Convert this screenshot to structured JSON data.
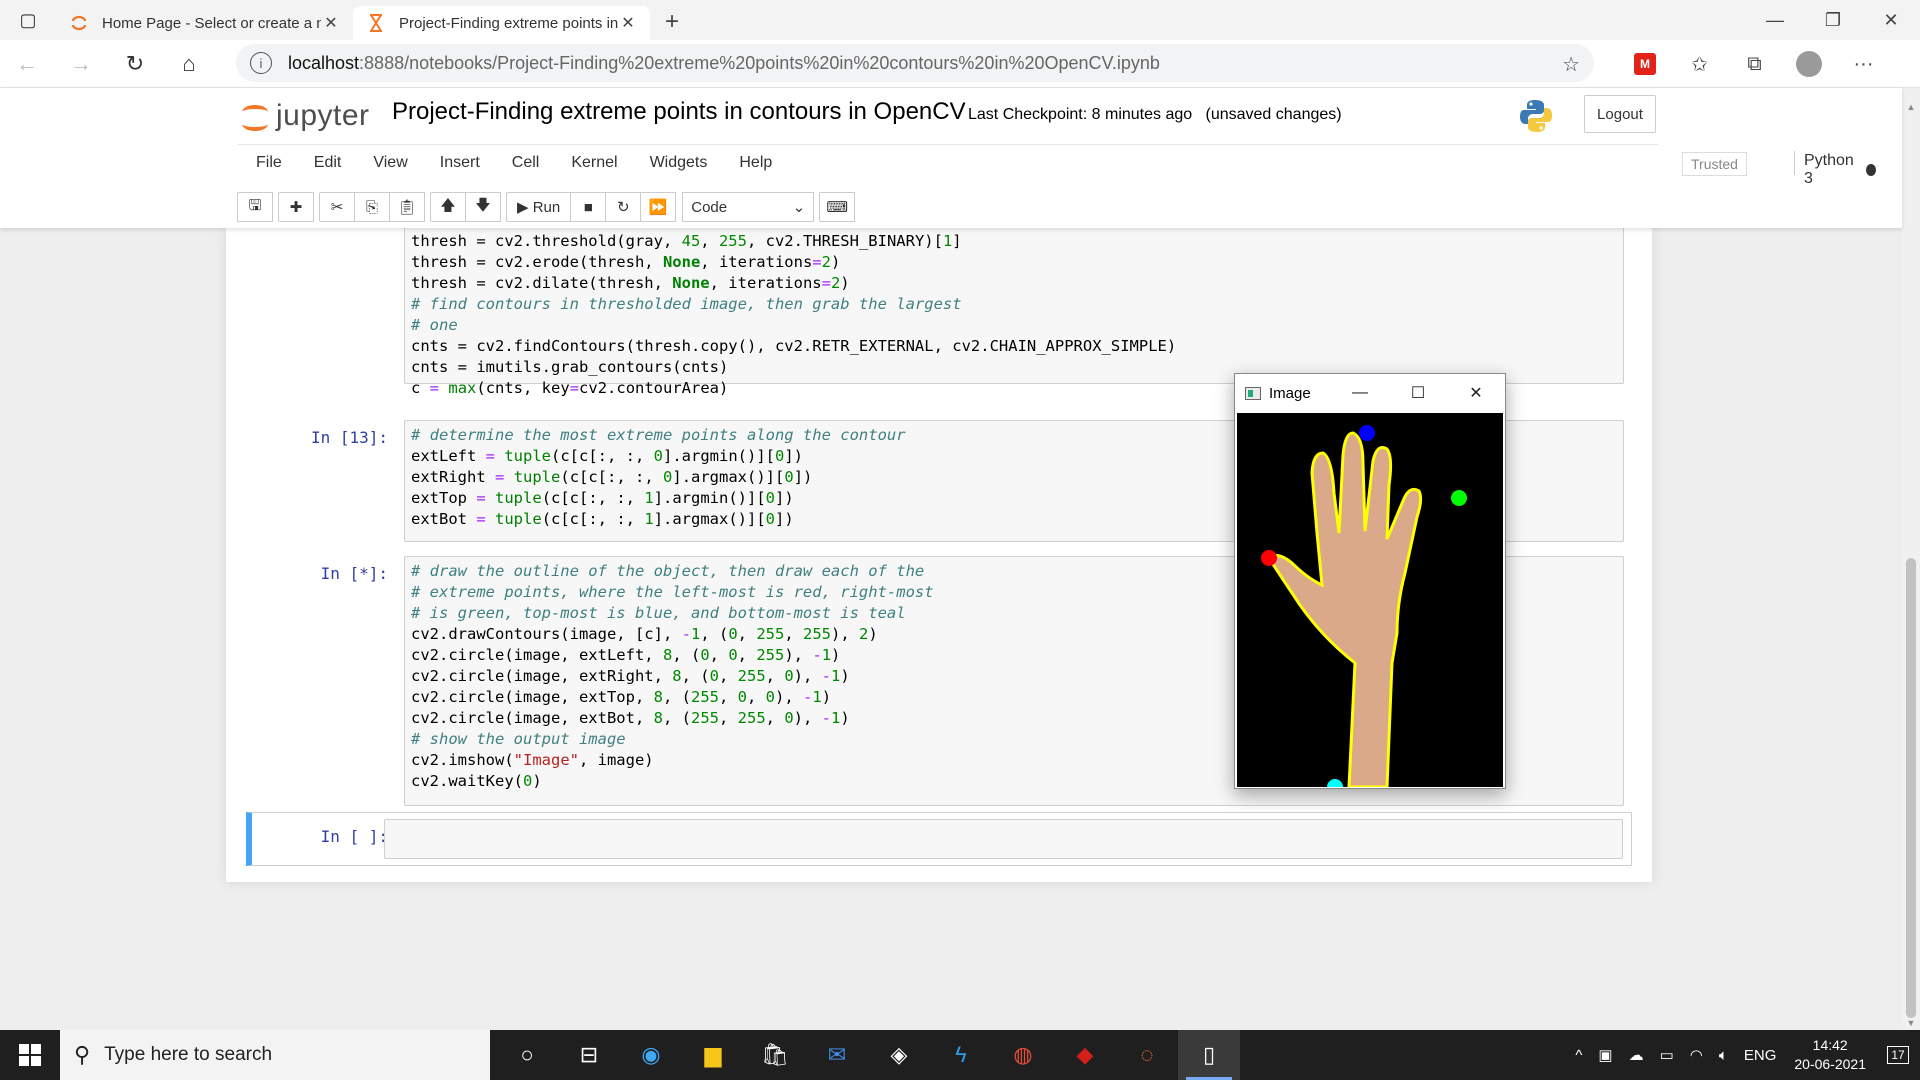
{
  "browser": {
    "tabs": [
      {
        "title": "Home Page - Select or create a n",
        "icon": "jupyter-spinner-icon",
        "active": false
      },
      {
        "title": "Project-Finding extreme points in",
        "icon": "hourglass-icon",
        "active": true
      }
    ],
    "url_host": "localhost",
    "url_path": ":8888/notebooks/Project-Finding%20extreme%20points%20in%20contours%20in%20OpenCV.ipynb"
  },
  "jupyter": {
    "logo_text": "jupyter",
    "notebook_title": "Project-Finding extreme points in contours in OpenCV",
    "checkpoint_label": "Last Checkpoint:",
    "checkpoint_time": "8 minutes ago",
    "unsaved": "(unsaved changes)",
    "logout_label": "Logout",
    "menu": [
      "File",
      "Edit",
      "View",
      "Insert",
      "Cell",
      "Kernel",
      "Widgets",
      "Help"
    ],
    "trusted_label": "Trusted",
    "kernel_name": "Python 3",
    "toolbar": {
      "run_label": "Run",
      "cell_type": "Code"
    }
  },
  "cells": [
    {
      "prompt": "",
      "lines": [
        "thresh = cv2.threshold(gray, 45, 255, cv2.THRESH_BINARY)[1]",
        "thresh = cv2.erode(thresh, None, iterations=2)",
        "thresh = cv2.dilate(thresh, None, iterations=2)",
        "# find contours in thresholded image, then grab the largest",
        "# one",
        "cnts = cv2.findContours(thresh.copy(), cv2.RETR_EXTERNAL, cv2.CHAIN_APPROX_SIMPLE)",
        "cnts = imutils.grab_contours(cnts)",
        "c = max(cnts, key=cv2.contourArea)"
      ]
    },
    {
      "prompt": "In [13]:",
      "lines": [
        "# determine the most extreme points along the contour",
        "extLeft = tuple(c[c[:, :, 0].argmin()][0])",
        "extRight = tuple(c[c[:, :, 0].argmax()][0])",
        "extTop = tuple(c[c[:, :, 1].argmin()][0])",
        "extBot = tuple(c[c[:, :, 1].argmax()][0])"
      ]
    },
    {
      "prompt": "In [*]:",
      "lines": [
        "# draw the outline of the object, then draw each of the",
        "# extreme points, where the left-most is red, right-most",
        "# is green, top-most is blue, and bottom-most is teal",
        "cv2.drawContours(image, [c], -1, (0, 255, 255), 2)",
        "cv2.circle(image, extLeft, 8, (0, 0, 255), -1)",
        "cv2.circle(image, extRight, 8, (0, 255, 0), -1)",
        "cv2.circle(image, extTop, 8, (255, 0, 0), -1)",
        "cv2.circle(image, extBot, 8, (255, 255, 0), -1)",
        "# show the output image",
        "cv2.imshow(\"Image\", image)",
        "cv2.waitKey(0)"
      ]
    },
    {
      "prompt": "In [ ]:",
      "lines": [
        ""
      ]
    }
  ],
  "image_window": {
    "title": "Image"
  },
  "taskbar": {
    "search_placeholder": "Type here to search",
    "language": "ENG",
    "time": "14:42",
    "date": "20-06-2021",
    "notification_count": "17"
  },
  "colors": {
    "accent_blue": "#42a5f5",
    "jupyter_orange": "#f37726",
    "prompt_blue": "#303f9f",
    "contour_yellow": "#ffff00"
  }
}
